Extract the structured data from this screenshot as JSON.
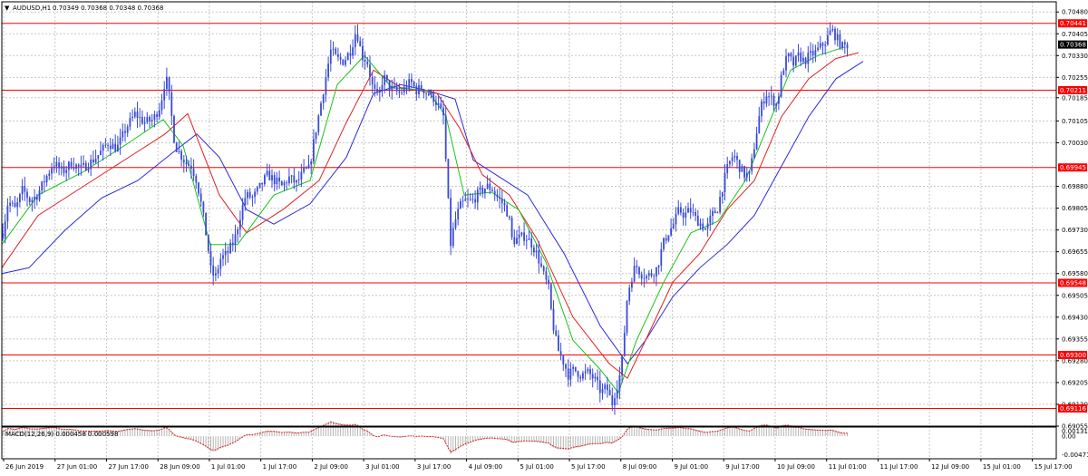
{
  "window": {
    "title": "AUDUSD,H1",
    "ohlc": "0.70349 0.70368 0.70348 0.70368"
  },
  "colors": {
    "candle": "#3a4bd6",
    "ma_fast": "#18c418",
    "ma_mid": "#e02020",
    "ma_slow": "#2a2ad8",
    "level_line": "#ff0000",
    "price_tag": "#ff0000",
    "current_tag": "#000000",
    "macd_hist": "#b4b4b4",
    "macd_signal": "#e02020"
  },
  "macd": {
    "label": "MACD(12,26,9) 0.000458 0.000598",
    "ticks": [
      "0.00131",
      "0.00",
      "-0.00471"
    ],
    "tick_values": [
      0.00131,
      0,
      -0.00471
    ],
    "ylim": [
      -0.0055,
      0.0021
    ]
  },
  "chart_data": {
    "type": "candlestick",
    "symbol": "AUDUSD",
    "timeframe": "H1",
    "ylim": [
      0.69055,
      0.70515
    ],
    "y_ticks": [
      "0.70480",
      "0.70405",
      "0.70330",
      "0.70255",
      "0.70185",
      "0.70105",
      "0.70030",
      "0.69880",
      "0.69805",
      "0.69730",
      "0.69655",
      "0.69580",
      "0.69505",
      "0.69430",
      "0.69355",
      "0.69280",
      "0.69205",
      "0.69130",
      "0.69055"
    ],
    "x_ticks": [
      "26 Jun 2019",
      "27 Jun 01:00",
      "27 Jun 17:00",
      "28 Jun 09:00",
      "1 Jul 01:00",
      "1 Jul 17:00",
      "2 Jul 09:00",
      "3 Jul 01:00",
      "3 Jul 17:00",
      "4 Jul 09:00",
      "5 Jul 01:00",
      "5 Jul 17:00",
      "8 Jul 09:00",
      "9 Jul 01:00",
      "9 Jul 17:00",
      "10 Jul 09:00",
      "11 Jul 01:00",
      "11 Jul 17:00",
      "12 Jul 09:00",
      "15 Jul 01:00",
      "15 Jul 17:00"
    ],
    "current_price": "0.70368",
    "current_value": 0.70368,
    "levels": [
      {
        "label": "0.70441",
        "value": 0.70441
      },
      {
        "label": "0.70211",
        "value": 0.70211
      },
      {
        "label": "0.69945",
        "value": 0.69945
      },
      {
        "label": "0.69548",
        "value": 0.69548
      },
      {
        "label": "0.69300",
        "value": 0.693
      },
      {
        "label": "0.69116",
        "value": 0.69116
      }
    ],
    "close_path": [
      [
        0,
        0.6972
      ],
      [
        6,
        0.6983
      ],
      [
        14,
        0.698
      ],
      [
        22,
        0.6987
      ],
      [
        30,
        0.6983
      ],
      [
        38,
        0.6985
      ],
      [
        46,
        0.699
      ],
      [
        56,
        0.6996
      ],
      [
        66,
        0.6993
      ],
      [
        76,
        0.6996
      ],
      [
        86,
        0.6994
      ],
      [
        96,
        0.6996
      ],
      [
        106,
        0.6999
      ],
      [
        116,
        0.7003
      ],
      [
        126,
        0.7001
      ],
      [
        136,
        0.7008
      ],
      [
        146,
        0.7013
      ],
      [
        156,
        0.701
      ],
      [
        166,
        0.7011
      ],
      [
        174,
        0.7016
      ],
      [
        180,
        0.7026
      ],
      [
        184,
        0.7018
      ],
      [
        190,
        0.7002
      ],
      [
        196,
        0.6999
      ],
      [
        202,
        0.6996
      ],
      [
        208,
        0.6995
      ],
      [
        214,
        0.699
      ],
      [
        220,
        0.698
      ],
      [
        226,
        0.6968
      ],
      [
        230,
        0.6958
      ],
      [
        235,
        0.6957
      ],
      [
        240,
        0.6963
      ],
      [
        248,
        0.6965
      ],
      [
        256,
        0.697
      ],
      [
        262,
        0.6978
      ],
      [
        268,
        0.6985
      ],
      [
        276,
        0.6984
      ],
      [
        284,
        0.6988
      ],
      [
        292,
        0.6992
      ],
      [
        300,
        0.699
      ],
      [
        308,
        0.6988
      ],
      [
        316,
        0.6991
      ],
      [
        324,
        0.6989
      ],
      [
        332,
        0.6993
      ],
      [
        338,
        0.6994
      ],
      [
        344,
        0.7005
      ],
      [
        350,
        0.7015
      ],
      [
        356,
        0.7025
      ],
      [
        362,
        0.7035
      ],
      [
        368,
        0.7032
      ],
      [
        376,
        0.7031
      ],
      [
        384,
        0.7035
      ],
      [
        390,
        0.7042
      ],
      [
        396,
        0.7033
      ],
      [
        402,
        0.7031
      ],
      [
        408,
        0.7022
      ],
      [
        414,
        0.7018
      ],
      [
        420,
        0.7026
      ],
      [
        426,
        0.7022
      ],
      [
        432,
        0.7021
      ],
      [
        438,
        0.702
      ],
      [
        444,
        0.7022
      ],
      [
        450,
        0.7024
      ],
      [
        456,
        0.7021
      ],
      [
        462,
        0.7022
      ],
      [
        468,
        0.702
      ],
      [
        474,
        0.7019
      ],
      [
        480,
        0.7016
      ],
      [
        486,
        0.7012
      ],
      [
        490,
        0.699
      ],
      [
        494,
        0.6968
      ],
      [
        498,
        0.6975
      ],
      [
        504,
        0.6981
      ],
      [
        510,
        0.6983
      ],
      [
        518,
        0.6983
      ],
      [
        526,
        0.6986
      ],
      [
        534,
        0.6988
      ],
      [
        540,
        0.6987
      ],
      [
        546,
        0.6984
      ],
      [
        552,
        0.6982
      ],
      [
        558,
        0.6978
      ],
      [
        562,
        0.6969
      ],
      [
        568,
        0.697
      ],
      [
        576,
        0.6971
      ],
      [
        584,
        0.6968
      ],
      [
        590,
        0.6964
      ],
      [
        596,
        0.6958
      ],
      [
        602,
        0.6953
      ],
      [
        606,
        0.6942
      ],
      [
        612,
        0.6932
      ],
      [
        618,
        0.6928
      ],
      [
        624,
        0.6923
      ],
      [
        630,
        0.6925
      ],
      [
        638,
        0.6923
      ],
      [
        646,
        0.6924
      ],
      [
        654,
        0.6921
      ],
      [
        660,
        0.6917
      ],
      [
        666,
        0.6919
      ],
      [
        672,
        0.6913
      ],
      [
        676,
        0.6918
      ],
      [
        680,
        0.6922
      ],
      [
        684,
        0.693
      ],
      [
        688,
        0.6948
      ],
      [
        692,
        0.6955
      ],
      [
        698,
        0.6961
      ],
      [
        704,
        0.6958
      ],
      [
        710,
        0.6957
      ],
      [
        716,
        0.6958
      ],
      [
        722,
        0.696
      ],
      [
        728,
        0.6968
      ],
      [
        734,
        0.6972
      ],
      [
        740,
        0.6975
      ],
      [
        746,
        0.698
      ],
      [
        752,
        0.6978
      ],
      [
        758,
        0.698
      ],
      [
        764,
        0.6977
      ],
      [
        770,
        0.6975
      ],
      [
        776,
        0.6973
      ],
      [
        782,
        0.6978
      ],
      [
        788,
        0.698
      ],
      [
        794,
        0.6988
      ],
      [
        800,
        0.6995
      ],
      [
        806,
        0.6999
      ],
      [
        812,
        0.6995
      ],
      [
        818,
        0.6992
      ],
      [
        824,
        0.6992
      ],
      [
        830,
        0.7004
      ],
      [
        836,
        0.7015
      ],
      [
        842,
        0.702
      ],
      [
        848,
        0.7018
      ],
      [
        854,
        0.7016
      ],
      [
        860,
        0.7028
      ],
      [
        866,
        0.7033
      ],
      [
        872,
        0.703
      ],
      [
        878,
        0.7033
      ],
      [
        884,
        0.7031
      ],
      [
        890,
        0.7033
      ],
      [
        896,
        0.7034
      ],
      [
        902,
        0.7036
      ],
      [
        908,
        0.7038
      ],
      [
        914,
        0.7042
      ],
      [
        920,
        0.7039
      ],
      [
        926,
        0.7036
      ],
      [
        932,
        0.70368
      ]
    ],
    "ma_fast_path": [
      [
        0,
        0.6968
      ],
      [
        40,
        0.6985
      ],
      [
        90,
        0.6993
      ],
      [
        140,
        0.7003
      ],
      [
        178,
        0.7011
      ],
      [
        200,
        0.7002
      ],
      [
        230,
        0.6968
      ],
      [
        260,
        0.6968
      ],
      [
        300,
        0.6985
      ],
      [
        340,
        0.699
      ],
      [
        370,
        0.7023
      ],
      [
        400,
        0.7033
      ],
      [
        430,
        0.7022
      ],
      [
        470,
        0.7021
      ],
      [
        490,
        0.7012
      ],
      [
        510,
        0.6985
      ],
      [
        540,
        0.6986
      ],
      [
        570,
        0.698
      ],
      [
        600,
        0.6962
      ],
      [
        630,
        0.6935
      ],
      [
        660,
        0.6925
      ],
      [
        680,
        0.6917
      ],
      [
        700,
        0.6935
      ],
      [
        730,
        0.6955
      ],
      [
        760,
        0.6972
      ],
      [
        790,
        0.6976
      ],
      [
        820,
        0.699
      ],
      [
        840,
        0.7005
      ],
      [
        870,
        0.7028
      ],
      [
        900,
        0.7033
      ],
      [
        930,
        0.7036
      ]
    ],
    "ma_mid_path": [
      [
        0,
        0.696
      ],
      [
        40,
        0.6978
      ],
      [
        90,
        0.6988
      ],
      [
        140,
        0.6998
      ],
      [
        180,
        0.7006
      ],
      [
        205,
        0.7013
      ],
      [
        240,
        0.6985
      ],
      [
        270,
        0.6972
      ],
      [
        310,
        0.698
      ],
      [
        350,
        0.699
      ],
      [
        380,
        0.701
      ],
      [
        410,
        0.7028
      ],
      [
        440,
        0.7022
      ],
      [
        480,
        0.702
      ],
      [
        505,
        0.7008
      ],
      [
        530,
        0.6992
      ],
      [
        560,
        0.6985
      ],
      [
        590,
        0.697
      ],
      [
        630,
        0.6943
      ],
      [
        670,
        0.6927
      ],
      [
        690,
        0.6922
      ],
      [
        710,
        0.6935
      ],
      [
        740,
        0.6955
      ],
      [
        770,
        0.6965
      ],
      [
        800,
        0.698
      ],
      [
        830,
        0.699
      ],
      [
        860,
        0.7012
      ],
      [
        890,
        0.7025
      ],
      [
        920,
        0.7032
      ],
      [
        945,
        0.7034
      ]
    ],
    "ma_slow_path": [
      [
        0,
        0.6958
      ],
      [
        30,
        0.696
      ],
      [
        70,
        0.6973
      ],
      [
        110,
        0.6984
      ],
      [
        150,
        0.699
      ],
      [
        190,
        0.7
      ],
      [
        215,
        0.7006
      ],
      [
        240,
        0.6998
      ],
      [
        270,
        0.698
      ],
      [
        300,
        0.6975
      ],
      [
        340,
        0.6982
      ],
      [
        380,
        0.6998
      ],
      [
        410,
        0.702
      ],
      [
        440,
        0.7023
      ],
      [
        470,
        0.7021
      ],
      [
        500,
        0.7018
      ],
      [
        520,
        0.6997
      ],
      [
        550,
        0.6991
      ],
      [
        580,
        0.6985
      ],
      [
        620,
        0.6965
      ],
      [
        660,
        0.694
      ],
      [
        690,
        0.6927
      ],
      [
        710,
        0.6935
      ],
      [
        740,
        0.695
      ],
      [
        770,
        0.696
      ],
      [
        800,
        0.6968
      ],
      [
        830,
        0.6978
      ],
      [
        860,
        0.6995
      ],
      [
        890,
        0.7012
      ],
      [
        920,
        0.7025
      ],
      [
        950,
        0.7031
      ]
    ]
  }
}
